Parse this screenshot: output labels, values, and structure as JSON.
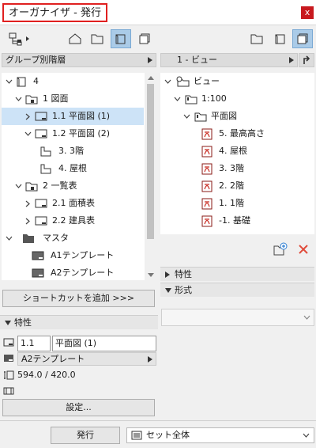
{
  "window": {
    "title": "オーガナイザ - 発行",
    "close": "x"
  },
  "left": {
    "dropdown": "グループ別階層",
    "tree": [
      {
        "label": "4"
      },
      {
        "label": "1 図面"
      },
      {
        "label": "1.1 平面図 (1)"
      },
      {
        "label": "1.2 平面図 (2)"
      },
      {
        "label": "3. 3階"
      },
      {
        "label": "4. 屋根"
      },
      {
        "label": "2 一覧表"
      },
      {
        "label": "2.1 面積表"
      },
      {
        "label": "2.2 建具表"
      },
      {
        "label": "マスタ"
      },
      {
        "label": "A1テンプレート"
      },
      {
        "label": "A2テンプレート"
      }
    ],
    "add_shortcut": "ショートカットを追加 >>>",
    "properties": {
      "header": "特性",
      "id_value": "1.1",
      "name_value": "平面図 (1)",
      "master_value": "A2テンプレート",
      "size_text": "594.0 / 420.0",
      "settings_button": "設定..."
    }
  },
  "right": {
    "dropdown": "1 - ビュー",
    "tree": [
      {
        "label": "ビュー"
      },
      {
        "label": "1:100"
      },
      {
        "label": "平面図"
      },
      {
        "label": "5. 最高高さ"
      },
      {
        "label": "4. 屋根"
      },
      {
        "label": "3. 3階"
      },
      {
        "label": "2. 2階"
      },
      {
        "label": "1. 1階"
      },
      {
        "label": "-1. 基礎"
      }
    ],
    "props_header": "特性",
    "format_header": "形式"
  },
  "footer": {
    "publish_button": "発行",
    "set_select": "セット全体"
  },
  "colors": {
    "accent": "#cde3f7",
    "close": "#c8191e",
    "highlight_border": "#e02020",
    "delete": "#e04a3a",
    "pdf_red": "#c8281e"
  }
}
